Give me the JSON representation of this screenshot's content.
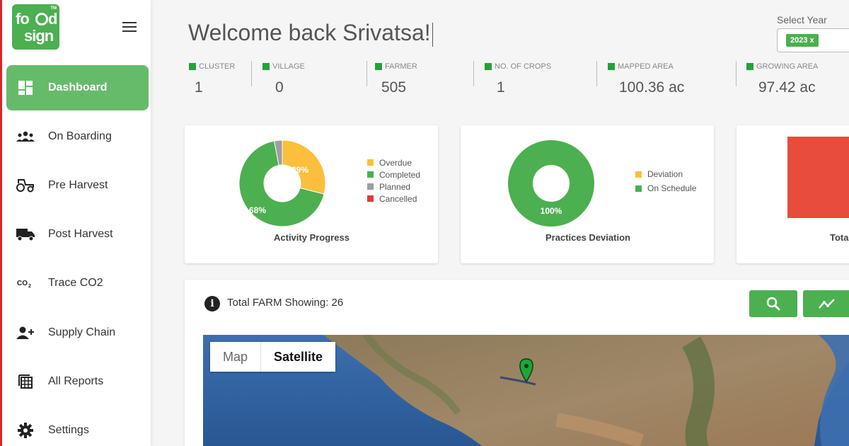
{
  "sidebar": {
    "items": [
      {
        "label": "Dashboard",
        "icon": "dashboard-icon",
        "active": true
      },
      {
        "label": "On Boarding",
        "icon": "group-icon"
      },
      {
        "label": "Pre Harvest",
        "icon": "tractor-icon"
      },
      {
        "label": "Post Harvest",
        "icon": "truck-icon"
      },
      {
        "label": "Trace CO2",
        "icon": "co2-icon"
      },
      {
        "label": "Supply Chain",
        "icon": "person-add-icon"
      },
      {
        "label": "All Reports",
        "icon": "reports-icon"
      },
      {
        "label": "Settings",
        "icon": "gear-icon"
      }
    ]
  },
  "header": {
    "welcome": "Welcome back Srivatsa!",
    "year_label": "Select Year",
    "year_chip": "2023 x"
  },
  "stats": [
    {
      "label": "CLUSTER",
      "value": "1"
    },
    {
      "label": "VILLAGE",
      "value": "0"
    },
    {
      "label": "FARMER",
      "value": "505"
    },
    {
      "label": "NO. OF CROPS",
      "value": "1"
    },
    {
      "label": "MAPPED AREA",
      "value": "100.36 ac"
    },
    {
      "label": "GROWING AREA",
      "value": "97.42 ac"
    }
  ],
  "charts": {
    "activity": {
      "title": "Activity Progress",
      "legend": [
        "Overdue",
        "Completed",
        "Planned",
        "Cancelled"
      ],
      "pct_overdue": "29%",
      "pct_completed": "68%"
    },
    "deviation": {
      "title": "Practices Deviation",
      "legend": [
        "Deviation",
        "On Schedule"
      ],
      "pct_on_schedule": "100%"
    },
    "third_title": "Tota"
  },
  "chart_data": [
    {
      "type": "pie",
      "title": "Activity Progress",
      "categories": [
        "Overdue",
        "Completed",
        "Planned",
        "Cancelled"
      ],
      "values": [
        29,
        68,
        3,
        0
      ],
      "colors": [
        "#fbbf3c",
        "#4caf50",
        "#9e9e9e",
        "#e53935"
      ]
    },
    {
      "type": "pie",
      "title": "Practices Deviation",
      "categories": [
        "Deviation",
        "On Schedule"
      ],
      "values": [
        0,
        100
      ],
      "colors": [
        "#fbbf3c",
        "#4caf50"
      ]
    }
  ],
  "map": {
    "farm_count": "Total FARM Showing: 26",
    "toggle_map": "Map",
    "toggle_satellite": "Satellite"
  },
  "colors": {
    "accent": "#4caf50",
    "sidebar_active": "#66bb6a",
    "overdue": "#fbbf3c",
    "cancelled": "#e53935"
  }
}
